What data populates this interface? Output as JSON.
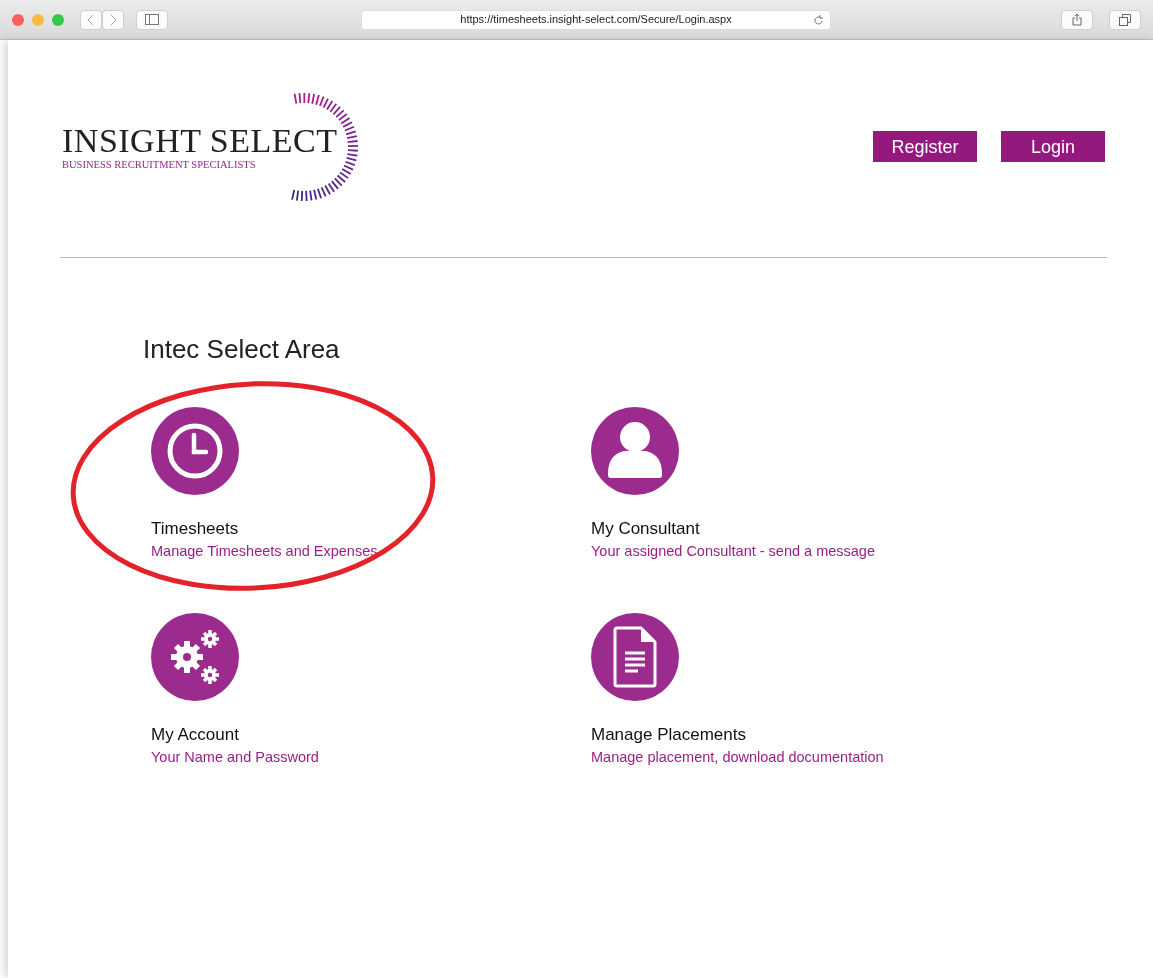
{
  "browser": {
    "url": "https://timesheets.insight-select.com/Secure/Login.aspx"
  },
  "logo": {
    "name": "INSIGHT SELECT",
    "tagline": "BUSINESS RECRUITMENT SPECIALISTS"
  },
  "header_buttons": [
    "Register",
    "Login"
  ],
  "heading": "Intec Select Area",
  "tiles": [
    {
      "kind": "clock",
      "title": "Timesheets",
      "subtitle": "Manage Timesheets and Expenses",
      "circled": true
    },
    {
      "kind": "person",
      "title": "My Consultant",
      "subtitle": "Your assigned Consultant - send a message",
      "circled": false
    },
    {
      "kind": "gears",
      "title": "My Account",
      "subtitle": "Your Name and Password",
      "circled": false
    },
    {
      "kind": "document",
      "title": "Manage Placements",
      "subtitle": "Manage placement, download documentation",
      "circled": false
    }
  ]
}
